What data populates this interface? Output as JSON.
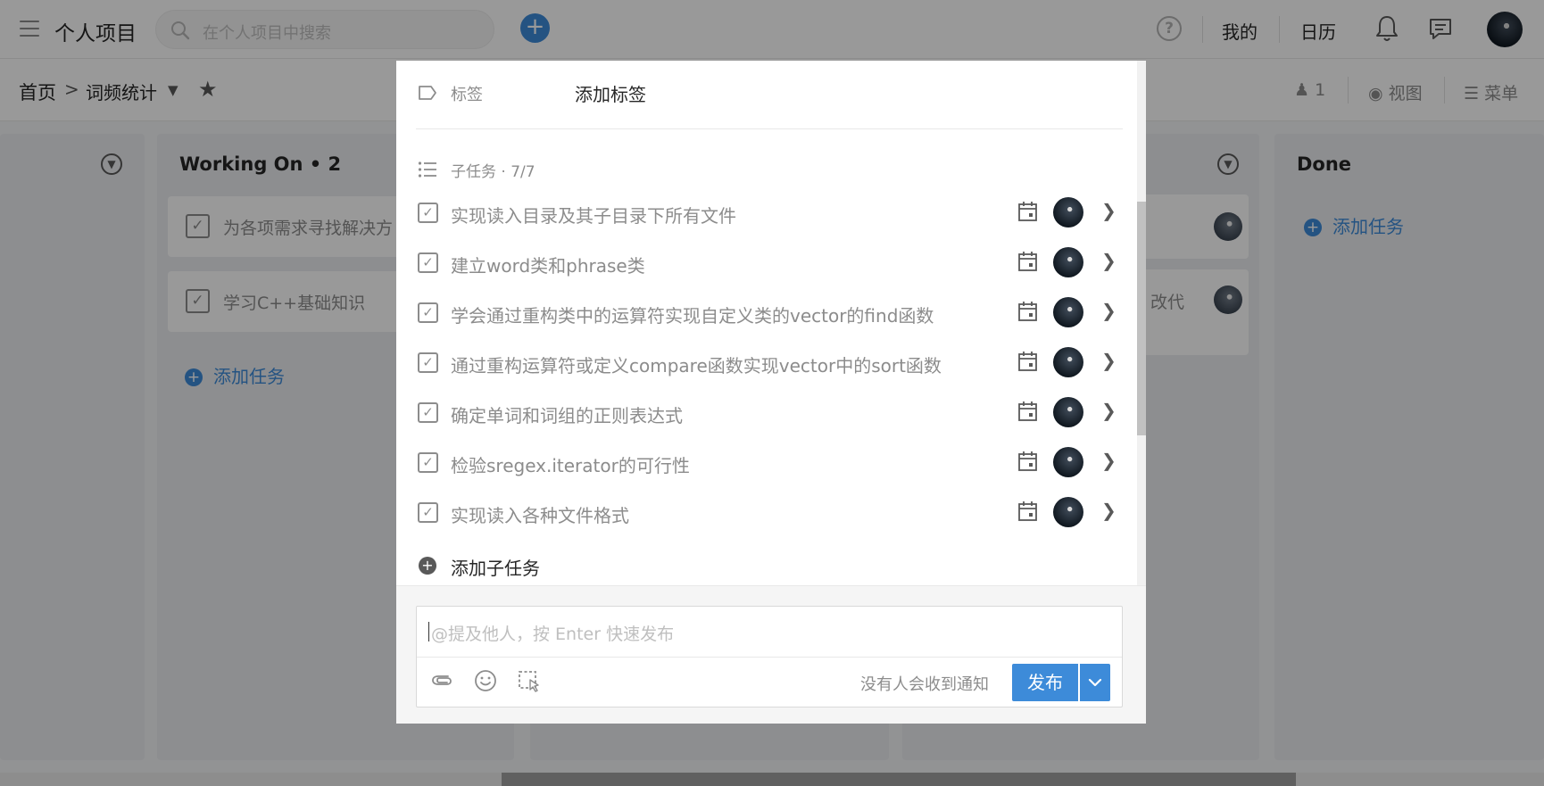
{
  "header": {
    "app_title": "个人项目",
    "search_placeholder": "在个人项目中搜索",
    "help": "?",
    "mine": "我的",
    "calendar": "日历",
    "icons": [
      "menu-icon",
      "search-icon",
      "plus-icon",
      "help-icon",
      "bell-icon",
      "chat-icon",
      "avatar"
    ]
  },
  "subheader": {
    "home": "首页",
    "separator": ">",
    "project": "词频统计",
    "members": "1",
    "view": "视图",
    "menu": "菜单"
  },
  "board": {
    "columns": [
      {
        "title": "",
        "cards": []
      },
      {
        "title": "Working On • 2",
        "cards": [
          {
            "text": "为各项需求寻找解决方"
          },
          {
            "text": "学习C++基础知识"
          }
        ],
        "add_label": "添加任务"
      },
      {
        "title": "",
        "cards": [
          {
            "text": ""
          },
          {
            "text": "改代"
          }
        ]
      },
      {
        "title": "Done",
        "cards": [],
        "add_label": "添加任务"
      }
    ]
  },
  "modal": {
    "tag_label": "标签",
    "tag_add": "添加标签",
    "subtasks_header": "子任务 · 7/7",
    "subtasks": [
      {
        "text": "实现读入目录及其子目录下所有文件",
        "done": true
      },
      {
        "text": "建立word类和phrase类",
        "done": true
      },
      {
        "text": "学会通过重构类中的运算符实现自定义类的vector的find函数",
        "done": true
      },
      {
        "text": "通过重构运算符或定义compare函数实现vector中的sort函数",
        "done": true
      },
      {
        "text": "确定单词和词组的正则表达式",
        "done": true
      },
      {
        "text": "检验sregex.iterator的可行性",
        "done": true
      },
      {
        "text": "实现读入各种文件格式",
        "done": true
      }
    ],
    "add_subtask": "添加子任务",
    "comment": {
      "placeholder": "@提及他人，按 Enter 快速发布",
      "notify": "没有人会收到通知",
      "publish": "发布"
    }
  },
  "colors": {
    "accent": "#3d8bd9",
    "overlay": "rgba(0,0,0,0.40)",
    "text_muted": "#8c8c8c"
  }
}
